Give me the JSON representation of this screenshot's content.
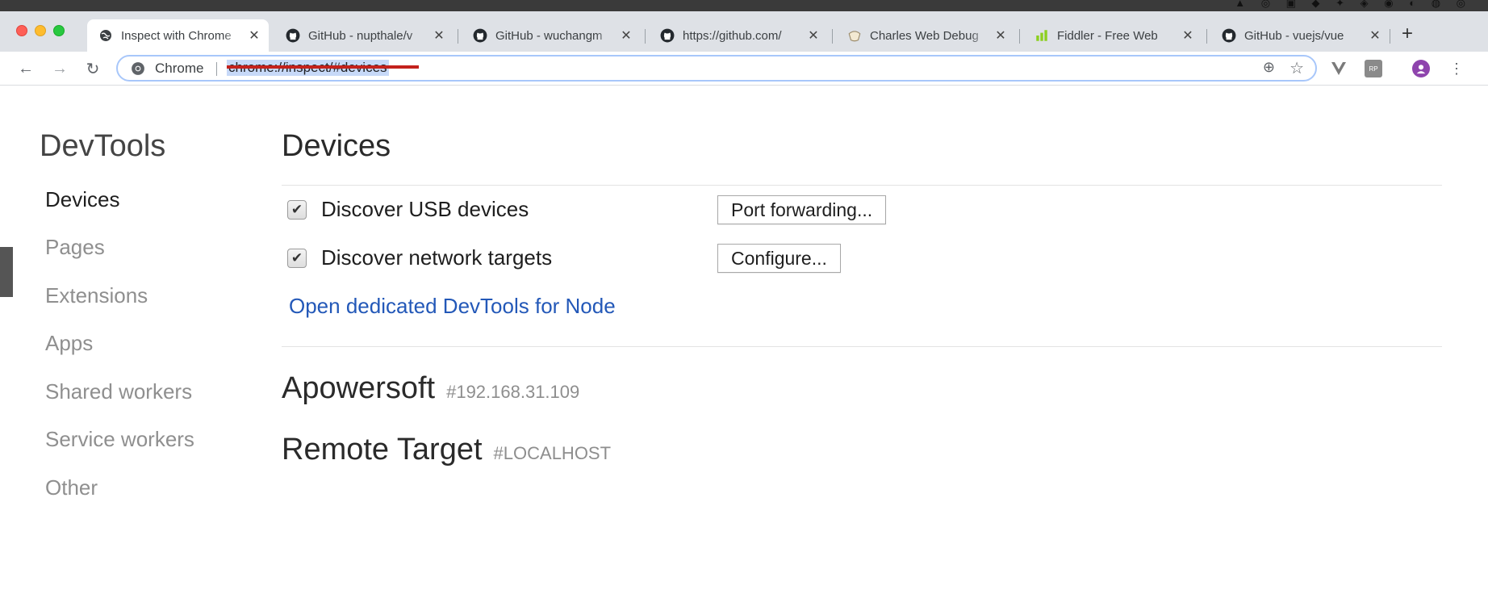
{
  "browser": {
    "tabs": [
      {
        "title": "Inspect with Chrome",
        "favicon": "globe-icon",
        "active": true
      },
      {
        "title": "GitHub - nupthale/v",
        "favicon": "github-icon"
      },
      {
        "title": "GitHub - wuchangm",
        "favicon": "github-icon"
      },
      {
        "title": "https://github.com/",
        "favicon": "github-icon"
      },
      {
        "title": "Charles Web Debug",
        "favicon": "charles-icon"
      },
      {
        "title": "Fiddler - Free Web",
        "favicon": "fiddler-icon"
      },
      {
        "title": "GitHub - vuejs/vue",
        "favicon": "github-icon"
      }
    ],
    "close_glyph": "✕",
    "new_tab_glyph": "+"
  },
  "toolbar": {
    "back_glyph": "←",
    "forward_glyph": "→",
    "reload_glyph": "↻",
    "origin_label": "Chrome",
    "url": "chrome://inspect/#devices",
    "zoom_glyph": "⊕",
    "star_glyph": "☆",
    "menu_glyph": "⋮",
    "ext_rp_label": "RP"
  },
  "sidebar": {
    "title": "DevTools",
    "items": [
      {
        "label": "Devices",
        "active": true
      },
      {
        "label": "Pages"
      },
      {
        "label": "Extensions"
      },
      {
        "label": "Apps"
      },
      {
        "label": "Shared workers"
      },
      {
        "label": "Service workers"
      },
      {
        "label": "Other"
      }
    ]
  },
  "main": {
    "title": "Devices",
    "options": [
      {
        "label": "Discover USB devices",
        "checked": true,
        "button": "Port forwarding..."
      },
      {
        "label": "Discover network targets",
        "checked": true,
        "button": "Configure..."
      }
    ],
    "node_link": "Open dedicated DevTools for Node",
    "targets": [
      {
        "name": "Apowersoft",
        "id": "#192.168.31.109"
      },
      {
        "name": "Remote Target",
        "id": "#LOCALHOST"
      }
    ]
  },
  "colors": {
    "link": "#2358b8",
    "url_highlight": "#c7d9f8",
    "annotation_underline": "#c3221c"
  }
}
